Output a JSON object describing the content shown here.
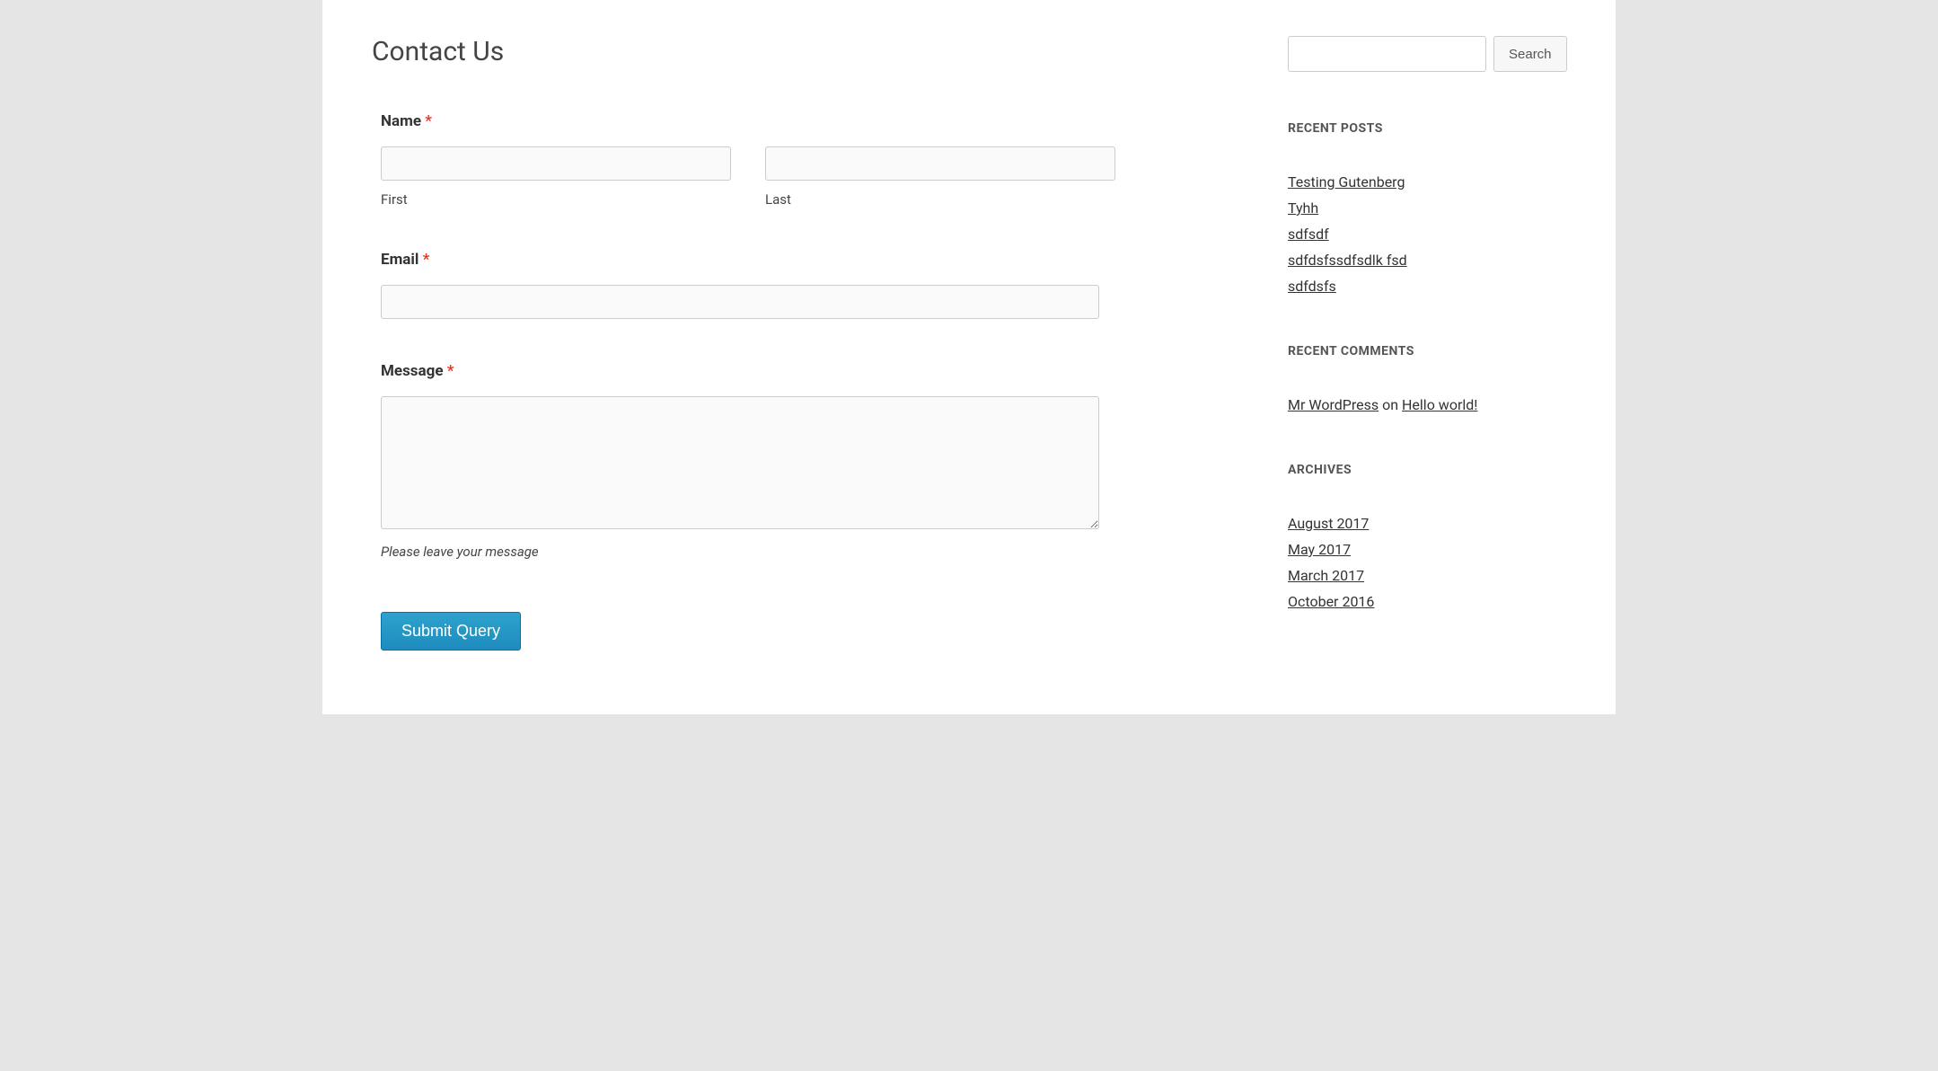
{
  "page": {
    "title": "Contact Us"
  },
  "form": {
    "name": {
      "label": "Name",
      "first_sublabel": "First",
      "last_sublabel": "Last"
    },
    "email": {
      "label": "Email"
    },
    "message": {
      "label": "Message",
      "help": "Please leave your message"
    },
    "submit_label": "Submit Query",
    "required_mark": "*"
  },
  "sidebar": {
    "search_button": "Search",
    "recent_posts": {
      "title": "RECENT POSTS",
      "items": [
        "Testing Gutenberg",
        "Tyhh",
        "sdfsdf",
        "sdfdsfssdfsdlk fsd",
        "sdfdsfs"
      ]
    },
    "recent_comments": {
      "title": "RECENT COMMENTS",
      "author": "Mr WordPress",
      "on_text": " on ",
      "post": "Hello world!"
    },
    "archives": {
      "title": "ARCHIVES",
      "items": [
        "August 2017",
        "May 2017",
        "March 2017",
        "October 2016"
      ]
    }
  }
}
